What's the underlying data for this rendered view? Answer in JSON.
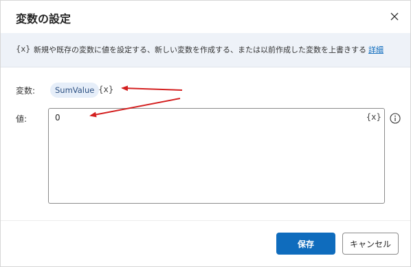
{
  "dialog": {
    "title": "変数の設定",
    "close_icon": "close-icon"
  },
  "info": {
    "var_icon_text": "{x}",
    "description": "新規や既存の変数に値を設定する、新しい変数を作成する、または以前作成した変数を上書きする",
    "link_label": "詳細"
  },
  "variable": {
    "label": "変数:",
    "name": "SumValue",
    "var_icon_text": "{x}"
  },
  "value": {
    "label": "値:",
    "current": "0",
    "var_icon_text": "{x}",
    "info_icon": "info-circle-icon"
  },
  "buttons": {
    "save": "保存",
    "cancel": "キャンセル"
  },
  "colors": {
    "accent": "#0f6cbd",
    "annotation_arrow": "#d42020",
    "chip_bg": "#e6eef9",
    "info_bar_bg": "#eef2f8"
  }
}
